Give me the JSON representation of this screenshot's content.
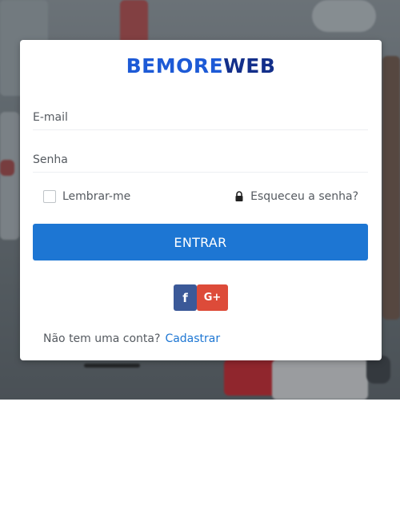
{
  "brand": {
    "part1": "BEMORE",
    "part2": "WEB"
  },
  "form": {
    "email_placeholder": "E-mail",
    "password_placeholder": "Senha",
    "remember_label": "Lembrar-me",
    "forgot_label": "Esqueceu a senha?",
    "submit_label": "ENTRAR"
  },
  "social": {
    "facebook_glyph": "f",
    "google_glyph": "G+"
  },
  "signup": {
    "prompt": "Não tem uma conta?",
    "link_label": "Cadastrar"
  },
  "colors": {
    "primary": "#1d76d3",
    "logo_light": "#1d5ad6",
    "logo_dark": "#132f8a",
    "facebook": "#3b5998",
    "google": "#dd4b39"
  },
  "icons": [
    "lock-icon",
    "facebook-icon",
    "google-plus-icon",
    "checkbox"
  ]
}
